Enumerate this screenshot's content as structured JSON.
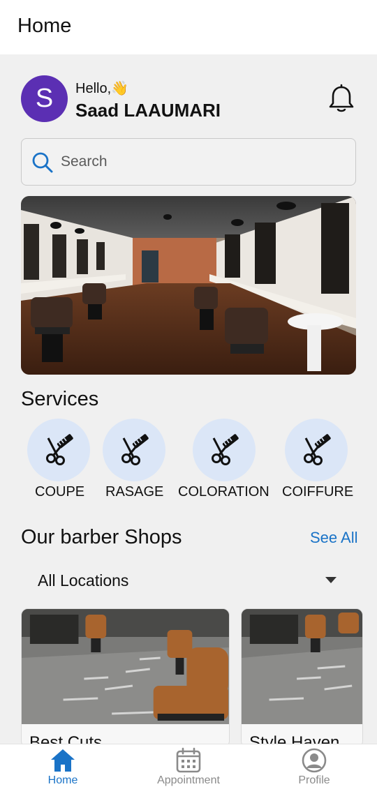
{
  "appbar": {
    "title": "Home"
  },
  "user": {
    "avatar_initial": "S",
    "greeting": "Hello,👋",
    "name": "Saad LAAUMARI"
  },
  "search": {
    "placeholder": "Search",
    "value": ""
  },
  "services": {
    "title": "Services",
    "items": [
      {
        "label": "COUPE",
        "icon": "scissors-comb-icon"
      },
      {
        "label": "RASAGE",
        "icon": "scissors-comb-icon"
      },
      {
        "label": "COLORATION",
        "icon": "scissors-comb-icon"
      },
      {
        "label": "COIFFURE",
        "icon": "scissors-comb-icon"
      }
    ]
  },
  "shops": {
    "title": "Our barber Shops",
    "see_all": "See All",
    "location_filter": "All Locations",
    "items": [
      {
        "name": "Best Cuts"
      },
      {
        "name": "Style Haven"
      }
    ]
  },
  "bottom_nav": {
    "items": [
      {
        "label": "Home",
        "icon": "home-icon",
        "active": true
      },
      {
        "label": "Appointment",
        "icon": "calendar-icon",
        "active": false
      },
      {
        "label": "Profile",
        "icon": "account-circle-icon",
        "active": false
      }
    ]
  },
  "colors": {
    "accent": "#1a73c7",
    "avatar": "#5b2fb3",
    "service_bg": "#dbe6f7",
    "page_bg": "#f0f0f0"
  }
}
